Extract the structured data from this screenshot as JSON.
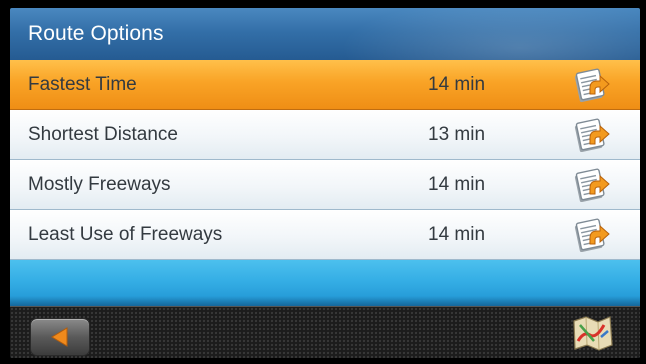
{
  "header": {
    "title": "Route Options"
  },
  "routes": [
    {
      "label": "Fastest Time",
      "time": "14 min",
      "selected": true,
      "icon": "route-detail-icon"
    },
    {
      "label": "Shortest Distance",
      "time": "13 min",
      "selected": false,
      "icon": "route-detail-icon"
    },
    {
      "label": "Mostly Freeways",
      "time": "14 min",
      "selected": false,
      "icon": "route-detail-icon"
    },
    {
      "label": "Least Use of Freeways",
      "time": "14 min",
      "selected": false,
      "icon": "route-detail-icon"
    }
  ],
  "toolbar": {
    "back_icon": "back-arrow-icon",
    "map_icon": "map-icon"
  },
  "colors": {
    "header": "#336fa8",
    "selected_row": "#f9a326",
    "row": "#f2f6f9",
    "filler": "#35aee5",
    "bottom_bar": "#1c1c1c",
    "back_arrow": "#f08a1c"
  }
}
